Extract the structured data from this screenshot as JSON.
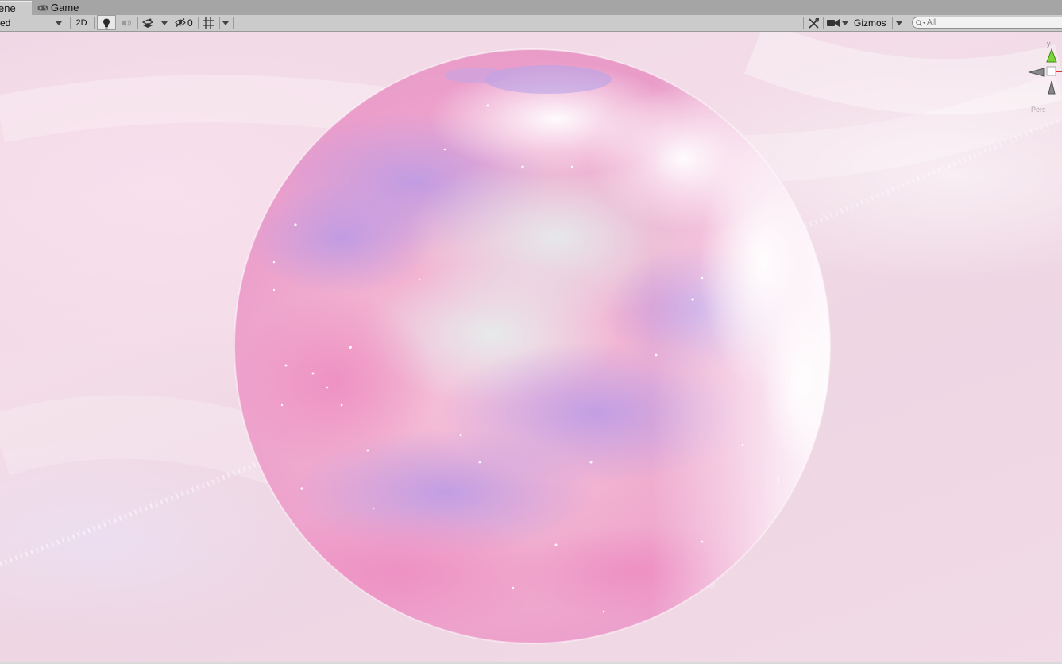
{
  "tabs": [
    {
      "label": "ene",
      "active": true
    },
    {
      "label": "Game",
      "icon": "gamepad-icon",
      "active": false
    }
  ],
  "toolbar": {
    "shading_mode": "ed",
    "mode_2d": "2D",
    "lighting_icon": "lightbulb-icon",
    "audio_icon": "audio-icon",
    "effects_icon": "effects-icon",
    "hidden_icon": "eye-slash-icon",
    "hidden_count": "0",
    "grid_icon": "grid-icon",
    "tools_icon": "tools-icon",
    "camera_icon": "camera-icon",
    "gizmos_label": "Gizmos",
    "search_placeholder": "All",
    "search_icon": "search-icon"
  },
  "scene": {
    "gizmo": {
      "y_label": "y",
      "persp_label": "Pers"
    },
    "colors": {
      "background": "#f1d8e5",
      "planet_pink": "#f3a8cf",
      "planet_lavender": "#c9a2ea",
      "planet_white": "#ffffff"
    }
  }
}
